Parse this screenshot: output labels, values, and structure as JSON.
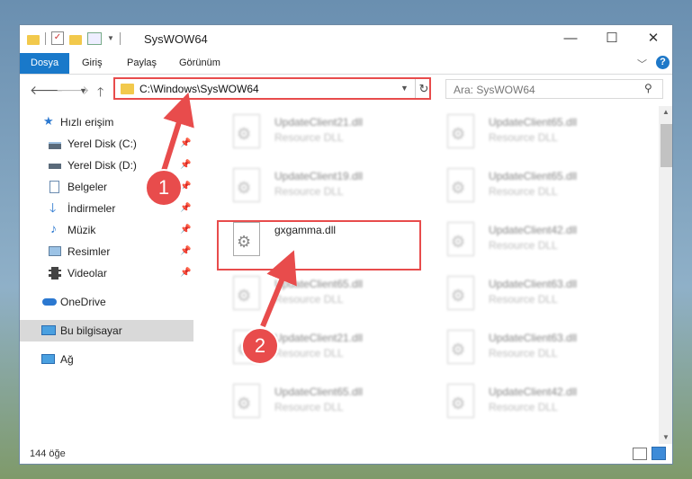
{
  "window": {
    "title": "SysWOW64",
    "controls": {
      "minimize": "—",
      "maximize": "☐",
      "close": "✕"
    }
  },
  "ribbon": {
    "tabs": [
      "Dosya",
      "Giriş",
      "Paylaş",
      "Görünüm"
    ],
    "help": "?"
  },
  "navigation": {
    "address": "C:\\Windows\\SysWOW64",
    "search_placeholder": "Ara: SysWOW64"
  },
  "sidebar": {
    "items": [
      {
        "label": "Hızlı erişim",
        "icon": "star-icon",
        "pinned": false
      },
      {
        "label": "Yerel Disk (C:)",
        "icon": "drive-icon",
        "pinned": true
      },
      {
        "label": "Yerel Disk (D:)",
        "icon": "drive-icon",
        "pinned": true
      },
      {
        "label": "Belgeler",
        "icon": "documents-icon",
        "pinned": true
      },
      {
        "label": "İndirmeler",
        "icon": "download-icon",
        "pinned": true
      },
      {
        "label": "Müzik",
        "icon": "music-icon",
        "pinned": true
      },
      {
        "label": "Resimler",
        "icon": "pictures-icon",
        "pinned": true
      },
      {
        "label": "Videolar",
        "icon": "videos-icon",
        "pinned": true
      },
      {
        "label": "OneDrive",
        "icon": "cloud-icon",
        "pinned": false
      },
      {
        "label": "Bu bilgisayar",
        "icon": "computer-icon",
        "pinned": false,
        "selected": true
      },
      {
        "label": "Ağ",
        "icon": "network-icon",
        "pinned": false
      }
    ]
  },
  "files": {
    "left": [
      {
        "name": "UpdateClient21.dll",
        "desc": "Resource DLL"
      },
      {
        "name": "UpdateClient19.dll",
        "desc": "Resource DLL"
      },
      {
        "name": "gxgamma.dll",
        "desc": "",
        "highlighted": true
      },
      {
        "name": "UpdateClient65.dll",
        "desc": "Resource DLL"
      },
      {
        "name": "UpdateClient21.dll",
        "desc": "Resource DLL"
      },
      {
        "name": "UpdateClient65.dll",
        "desc": "Resource DLL"
      }
    ],
    "right": [
      {
        "name": "UpdateClient65.dll",
        "desc": "Resource DLL"
      },
      {
        "name": "UpdateClient65.dll",
        "desc": "Resource DLL"
      },
      {
        "name": "UpdateClient42.dll",
        "desc": "Resource DLL"
      },
      {
        "name": "UpdateClient63.dll",
        "desc": "Resource DLL"
      },
      {
        "name": "UpdateClient63.dll",
        "desc": "Resource DLL"
      },
      {
        "name": "UpdateClient42.dll",
        "desc": "Resource DLL"
      }
    ]
  },
  "status": {
    "item_count": "144 öğe"
  },
  "annotations": {
    "step1": "1",
    "step2": "2",
    "color": "#e84c4c"
  }
}
